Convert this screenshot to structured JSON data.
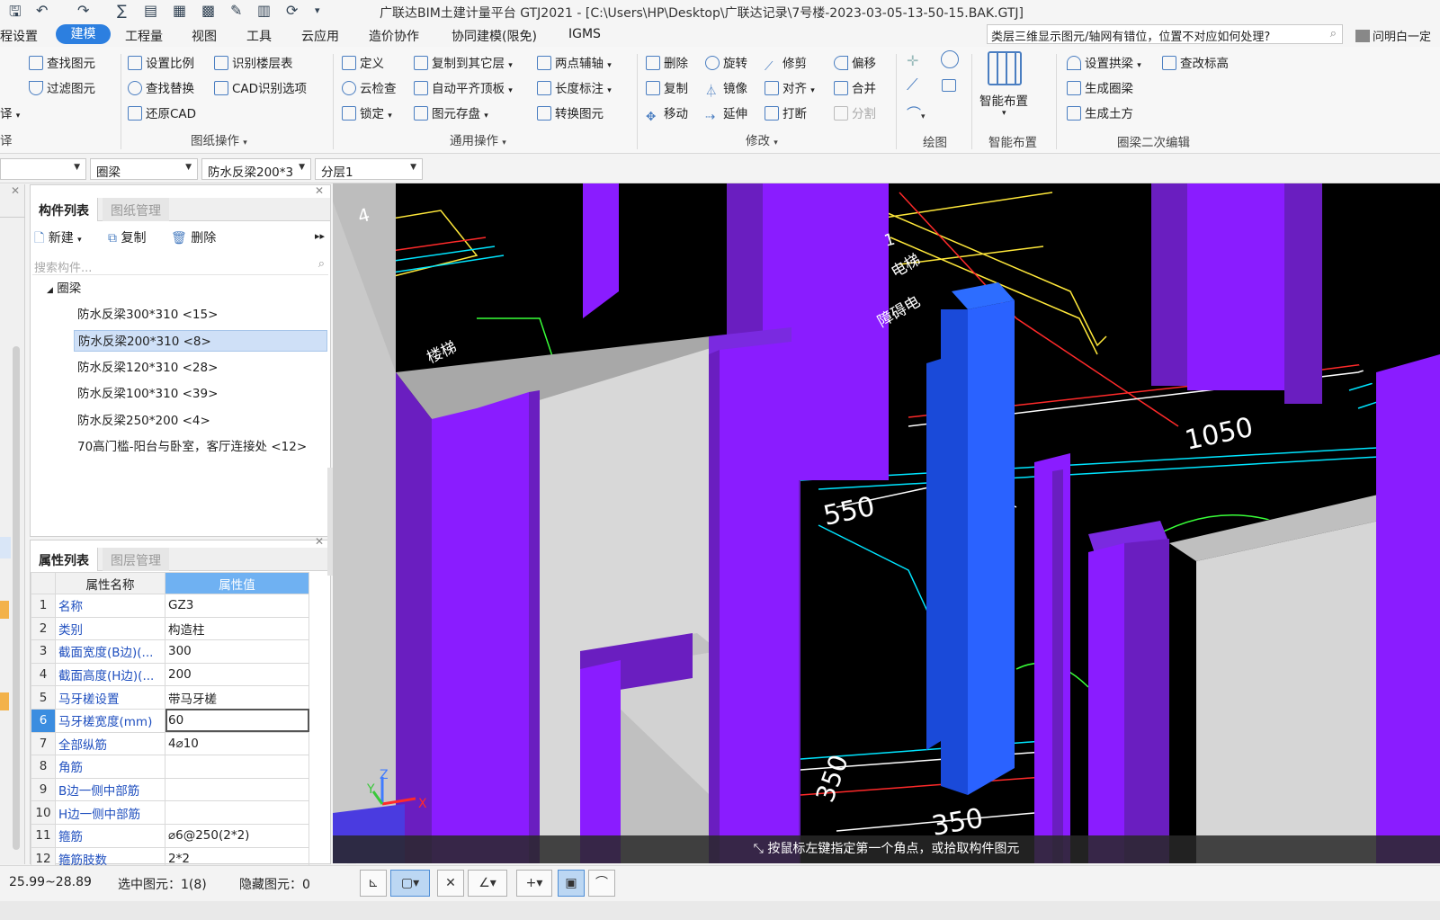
{
  "titlebar": {
    "title": "广联达BIM土建计量平台 GTJ2021 - [C:\\Users\\HP\\Desktop\\广联达记录\\7号楼-2023-03-05-13-50-15.BAK.GTJ]"
  },
  "menu": {
    "items": [
      "程设置",
      "工程量",
      "视图",
      "工具",
      "云应用",
      "造价协作",
      "协同建模(限免)",
      "IGMS"
    ],
    "active": "建模"
  },
  "help": {
    "text": "类层三维显示图元/轴网有错位，位置不对应如何处理?",
    "user": "问明白一定"
  },
  "ribbon": {
    "col1": [
      "查找图元",
      "过滤图元",
      "译"
    ],
    "col2": [
      "设置比例",
      "查找替换",
      "还原CAD"
    ],
    "col3": [
      "识别楼层表",
      "CAD识别选项"
    ],
    "col4": [
      "定义",
      "云检查",
      "锁定"
    ],
    "col5": [
      "复制到其它层",
      "自动平齐顶板",
      "图元存盘"
    ],
    "col6": [
      "两点辅轴",
      "长度标注",
      "转换图元"
    ],
    "col7": [
      "删除",
      "复制",
      "移动"
    ],
    "col8": [
      "旋转",
      "镜像",
      "延伸"
    ],
    "col9": [
      "修剪",
      "对齐",
      "打断"
    ],
    "col10": [
      "偏移",
      "合并",
      "分割"
    ],
    "smart": "智能布置",
    "col11": [
      "设置拱梁",
      "生成圈梁",
      "生成土方"
    ],
    "col12": [
      "查改标高"
    ],
    "groups": [
      "译",
      "图纸操作",
      "通用操作",
      "修改",
      "绘图",
      "智能布置",
      "圈梁二次编辑"
    ]
  },
  "combos": {
    "c1": "",
    "c2": "圈梁",
    "c3": "防水反梁200*3",
    "c4": "分层1"
  },
  "component_panel": {
    "tabs": [
      "构件列表",
      "图纸管理"
    ],
    "toolbar": [
      "新建",
      "复制",
      "删除"
    ],
    "search_placeholder": "搜索构件...",
    "root": "圈梁",
    "items": [
      "防水反梁300*310 <15>",
      "防水反梁200*310 <8>",
      "防水反梁120*310 <28>",
      "防水反梁100*310 <39>",
      "防水反梁250*200 <4>",
      "70高门槛-阳台与卧室，客厅连接处 <12>"
    ],
    "selected_index": 1
  },
  "property_panel": {
    "tabs": [
      "属性列表",
      "图层管理"
    ],
    "headers": [
      "属性名称",
      "属性值"
    ],
    "rows": [
      {
        "n": "1",
        "k": "名称",
        "v": "GZ3"
      },
      {
        "n": "2",
        "k": "类别",
        "v": "构造柱"
      },
      {
        "n": "3",
        "k": "截面宽度(B边)(...",
        "v": "300"
      },
      {
        "n": "4",
        "k": "截面高度(H边)(...",
        "v": "200"
      },
      {
        "n": "5",
        "k": "马牙槎设置",
        "v": "带马牙槎"
      },
      {
        "n": "6",
        "k": "马牙槎宽度(mm)",
        "v": "60"
      },
      {
        "n": "7",
        "k": "全部纵筋",
        "v": "4⌀10"
      },
      {
        "n": "8",
        "k": "角筋",
        "v": ""
      },
      {
        "n": "9",
        "k": "B边一侧中部筋",
        "v": ""
      },
      {
        "n": "10",
        "k": "H边一侧中部筋",
        "v": ""
      },
      {
        "n": "11",
        "k": "箍筋",
        "v": "⌀6@250(2*2)"
      },
      {
        "n": "12",
        "k": "箍筋肢数",
        "v": "2*2"
      }
    ],
    "current_row": 5
  },
  "viewport": {
    "labels": [
      "4",
      "1",
      "电梯",
      "障碍电",
      "楼梯",
      "1050",
      "550",
      "350",
      "350"
    ],
    "hint": "按鼠标左键指定第一个角点，或拾取构件图元",
    "axes": {
      "x": "X",
      "y": "Y",
      "z": "Z"
    }
  },
  "status": {
    "range": "25.99~28.89",
    "selected": "选中图元：1(8)",
    "hidden": "隐藏图元：0"
  },
  "colors": {
    "accent": "#2c7fe0",
    "purple": "#8a1cff",
    "blue_column": "#1f5fff",
    "wall_gray": "#d6d6d6"
  }
}
